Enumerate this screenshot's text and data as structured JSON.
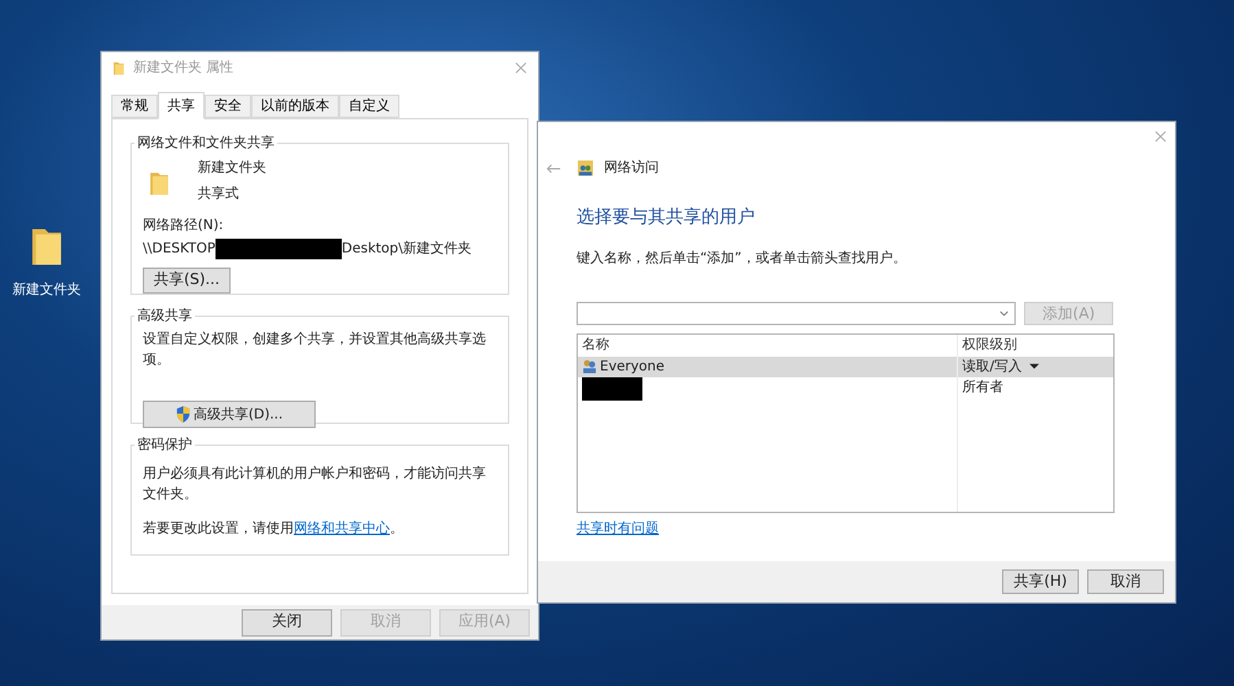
{
  "desktop_icons": [
    {
      "label": "新建文件夹"
    }
  ],
  "properties_dialog": {
    "title": "新建文件夹 属性",
    "tabs": [
      {
        "label": "常规",
        "selected": false
      },
      {
        "label": "共享",
        "selected": true
      },
      {
        "label": "安全",
        "selected": false
      },
      {
        "label": "以前的版本",
        "selected": false
      },
      {
        "label": "自定义",
        "selected": false
      }
    ],
    "network_sharing": {
      "heading": "网络文件和文件夹共享",
      "folder_name": "新建文件夹",
      "folder_status": "共享式",
      "path_label": "网络路径(N):",
      "path_start": "\\\\DESKTOP",
      "path_end": "Desktop\\新建文件夹",
      "share_button": "共享(S)..."
    },
    "advanced_sharing": {
      "heading": "高级共享",
      "description": "设置自定义权限，创建多个共享，并设置其他高级共享选项。",
      "button": "高级共享(D)..."
    },
    "password_protection": {
      "heading": "密码保护",
      "description": "用户必须具有此计算机的用户帐户和密码，才能访问共享文件夹。",
      "hint": "若要更改此设置，请使用",
      "link": "网络和共享中心",
      "hint_end": "。"
    },
    "buttons": [
      {
        "label": "关闭",
        "disabled": false
      },
      {
        "label": "取消",
        "disabled": true
      },
      {
        "label": "应用(A)",
        "disabled": true
      }
    ]
  },
  "network_access_dialog": {
    "nav_title": "网络访问",
    "heading": "选择要与其共享的用户",
    "instruction": "键入名称，然后单击“添加”，或者单击箭头查找用户。",
    "add_button": {
      "label": "添加(A)",
      "disabled": true
    },
    "columns": [
      "名称",
      "权限级别"
    ],
    "rows": [
      {
        "name": "Everyone",
        "permission": "读取/写入",
        "selected": true
      },
      {
        "name": "",
        "permission": "所有者",
        "selected": false
      }
    ],
    "help_link": "共享时有问题",
    "buttons": [
      {
        "label": "共享(H)"
      },
      {
        "label": "取消"
      }
    ]
  }
}
